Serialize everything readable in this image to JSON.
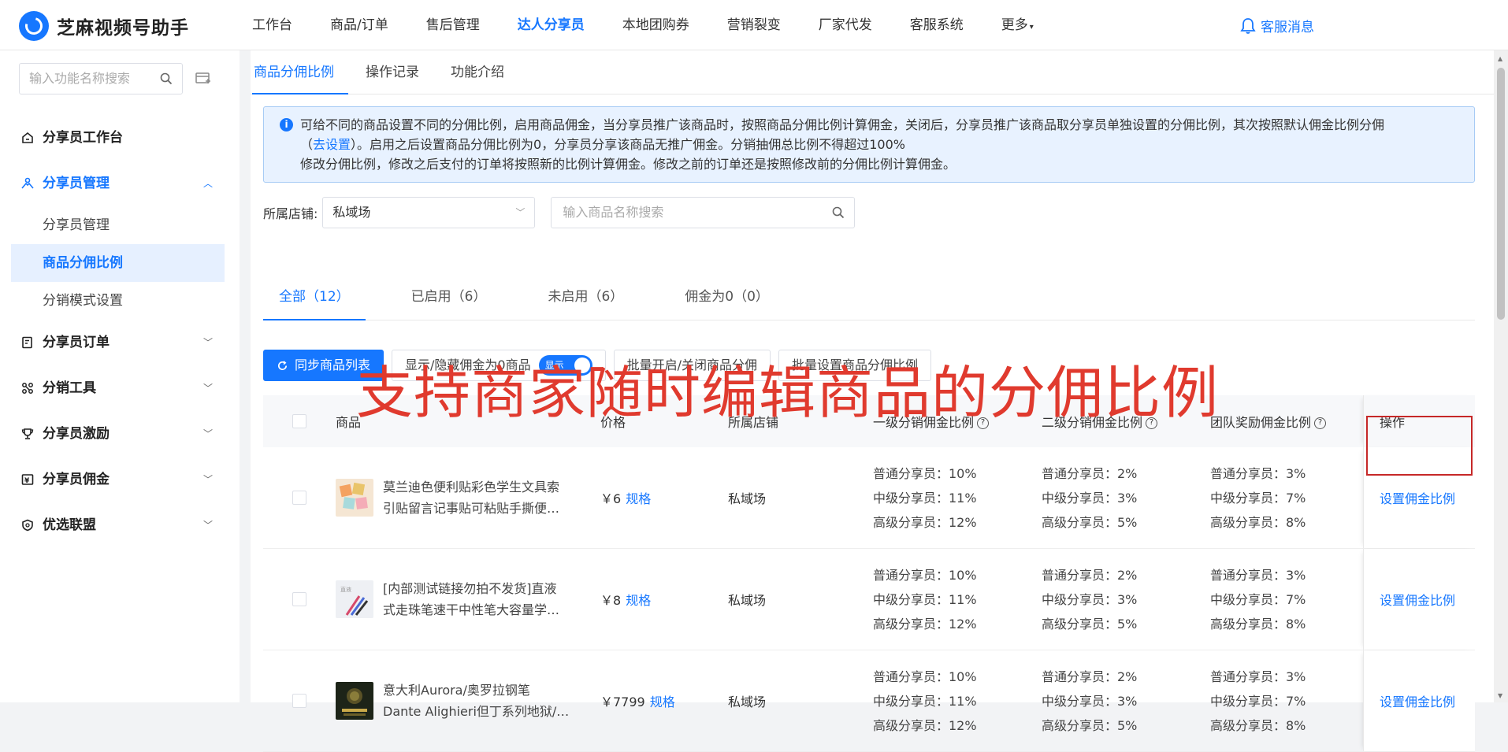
{
  "app": {
    "title": "芝麻视频号助手"
  },
  "nav": {
    "items": [
      "工作台",
      "商品/订单",
      "售后管理",
      "达人分享员",
      "本地团购券",
      "营销裂变",
      "厂家代发",
      "客服系统",
      "更多"
    ],
    "active_index": 3,
    "message_label": "客服消息"
  },
  "sidebar": {
    "search_placeholder": "输入功能名称搜索",
    "groups": [
      {
        "label": "分享员工作台",
        "icon": "home-icon"
      },
      {
        "label": "分享员管理",
        "icon": "share-user-icon",
        "open": true,
        "children": [
          "分享员管理",
          "商品分佣比例",
          "分销模式设置"
        ],
        "active_child": 1
      },
      {
        "label": "分享员订单",
        "icon": "order-icon"
      },
      {
        "label": "分销工具",
        "icon": "tools-icon"
      },
      {
        "label": "分享员激励",
        "icon": "trophy-icon"
      },
      {
        "label": "分享员佣金",
        "icon": "commission-icon"
      },
      {
        "label": "优选联盟",
        "icon": "shield-icon"
      }
    ]
  },
  "subtabs": [
    "商品分佣比例",
    "操作记录",
    "功能介绍"
  ],
  "notice": {
    "line1": "可给不同的商品设置不同的分佣比例，启用商品佣金，当分享员推广该商品时，按照商品分佣比例计算佣金，关闭后，分享员推广该商品取分享员单独设置的分佣比例，其次按照默认佣金比例分佣",
    "line2_prefix": "（",
    "line2_link": "去设置",
    "line2_rest": "）。启用之后设置商品分佣比例为0，分享员分享该商品无推广佣金。分销抽佣总比例不得超过100%",
    "line3": "修改分佣比例，修改之后支付的订单将按照新的比例计算佣金。修改之前的订单还是按照修改前的分佣比例计算佣金。"
  },
  "filter": {
    "shop_label": "所属店铺:",
    "shop_value": "私域场",
    "search_placeholder": "输入商品名称搜索"
  },
  "tabs": [
    "全部（12）",
    "已启用（6）",
    "未启用（6）",
    "佣金为0（0）"
  ],
  "actions": {
    "sync": "同步商品列表",
    "toggle_label": "显示/隐藏佣金为0商品",
    "toggle_state": "显示",
    "batch_toggle": "批量开启/关闭商品分佣",
    "batch_set": "批量设置商品分佣比例"
  },
  "table": {
    "headers": {
      "goods": "商品",
      "price": "价格",
      "shop": "所属店铺",
      "lv1": "一级分销佣金比例",
      "lv2": "二级分销佣金比例",
      "team": "团队奖励佣金比例",
      "op": "操作"
    },
    "rows": [
      {
        "name1": "莫兰迪色便利贴彩色学生文具索",
        "name2": "引贴留言记事贴可粘贴手撕便…",
        "price": "￥6",
        "spec": "规格",
        "shop": "私域场",
        "lv1": [
          "普通分享员：10%",
          "中级分享员：11%",
          "高级分享员：12%"
        ],
        "lv2": [
          "普通分享员：2%",
          "中级分享员：3%",
          "高级分享员：5%"
        ],
        "team": [
          "普通分享员：3%",
          "中级分享员：7%",
          "高级分享员：8%"
        ],
        "op": "设置佣金比例"
      },
      {
        "name1": "[内部测试链接勿拍不发货]直液",
        "name2": "式走珠笔速干中性笔大容量学…",
        "price": "￥8",
        "spec": "规格",
        "shop": "私域场",
        "lv1": [
          "普通分享员：10%",
          "中级分享员：11%",
          "高级分享员：12%"
        ],
        "lv2": [
          "普通分享员：2%",
          "中级分享员：3%",
          "高级分享员：5%"
        ],
        "team": [
          "普通分享员：3%",
          "中级分享员：7%",
          "高级分享员：8%"
        ],
        "op": "设置佣金比例"
      },
      {
        "name1": "意大利Aurora/奥罗拉钢笔",
        "name2": "Dante Alighieri但丁系列地狱/…",
        "price": "￥7799",
        "spec": "规格",
        "shop": "私域场",
        "lv1": [
          "普通分享员：10%",
          "中级分享员：11%",
          "高级分享员：12%"
        ],
        "lv2": [
          "普通分享员：2%",
          "中级分享员：3%",
          "高级分享员：5%"
        ],
        "team": [
          "普通分享员：3%",
          "中级分享员：7%",
          "高级分享员：8%"
        ],
        "op": "设置佣金比例"
      }
    ]
  },
  "overlay_caption": "支持商家随时编辑商品的分佣比例",
  "colors": {
    "accent": "#1677ff",
    "caption": "#e03a2e",
    "highlight": "#c62828"
  }
}
